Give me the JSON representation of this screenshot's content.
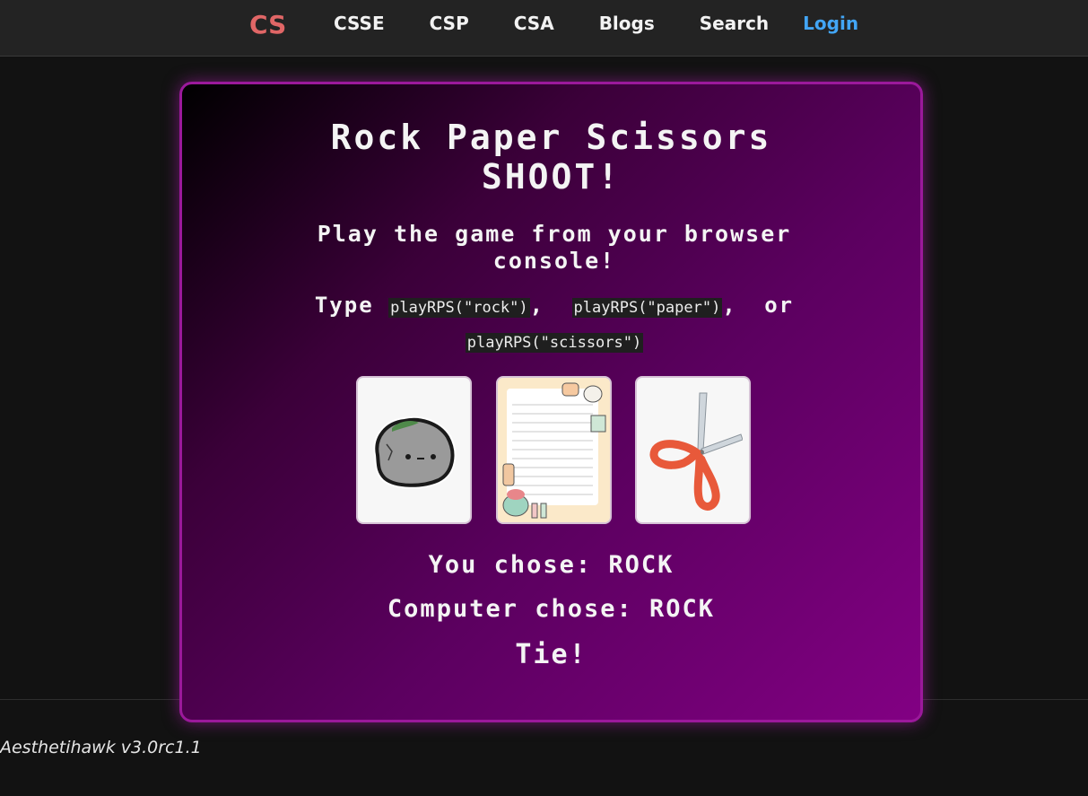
{
  "nav": {
    "logo": "CS",
    "links": [
      "CSSE",
      "CSP",
      "CSA",
      "Blogs",
      "Search"
    ],
    "login": "Login"
  },
  "game": {
    "title_line1": "Rock Paper Scissors",
    "title_line2": "SHOOT!",
    "subtitle": "Play the game from your browser console!",
    "type_prefix": "Type",
    "cmd_rock": "playRPS(\"rock\")",
    "cmd_paper": "playRPS(\"paper\")",
    "cmd_scissors": "playRPS(\"scissors\")",
    "sep": ",",
    "or": "or",
    "choices": [
      {
        "icon": "rock-image"
      },
      {
        "icon": "paper-image"
      },
      {
        "icon": "scissors-image"
      }
    ],
    "you_chose_label": "You chose:",
    "you_chose_value": "ROCK",
    "computer_chose_label": "Computer chose:",
    "computer_chose_value": "ROCK",
    "outcome": "Tie!"
  },
  "footer": {
    "version": "Aesthetihawk v3.0rc1.1"
  },
  "colors": {
    "accent_login": "#42a5f5",
    "logo": "#e06666",
    "card_border": "#9b199b"
  }
}
